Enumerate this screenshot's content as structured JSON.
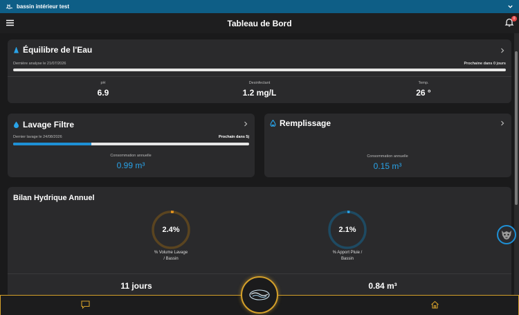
{
  "pool_bar": {
    "name": "bassin intérieur test"
  },
  "header": {
    "title": "Tableau de Bord",
    "notification_count": "0"
  },
  "water_balance": {
    "title": "Équilibre de l'Eau",
    "last_analysis": "Dernière analyse le 21/07/2026",
    "next": "Prochaine dans 0 jours",
    "progress": 1.0,
    "metrics": [
      {
        "label": "pH",
        "value": "6.9"
      },
      {
        "label": "Desinfectant",
        "value": "1.2 mg/L"
      },
      {
        "label": "Temp.",
        "value": "26 °"
      }
    ]
  },
  "filter_wash": {
    "title": "Lavage Filtre",
    "last_wash": "Dernier lavage le 24/08/2026",
    "next": "Prochain dans 5j",
    "progress": 0.33,
    "consumption_label": "Consommation annuelle",
    "consumption_value": "0.99 m³"
  },
  "filling": {
    "title": "Remplissage",
    "consumption_label": "Consommation annuelle",
    "consumption_value": "0.15 m³"
  },
  "annual": {
    "title": "Bilan Hydrique Annuel",
    "rings": [
      {
        "value": "2.4%",
        "fraction": 0.024,
        "label_line1": "% Volume Lavage",
        "label_line2": "/ Bassin",
        "color": "#e8961e",
        "track": "#5a4420"
      },
      {
        "value": "2.1%",
        "fraction": 0.021,
        "label_line1": "% Apport Pluie /",
        "label_line2": "Bassin",
        "color": "#29a3e8",
        "track": "#1e4a62"
      }
    ],
    "stats": [
      "11 jours",
      "0.84 m³"
    ]
  },
  "colors": {
    "accent": "#1e90d6",
    "gold": "#d4a02a",
    "pool_bar": "#0e5e86"
  },
  "icons": [
    "pool-icon",
    "chevron-down-icon",
    "menu-icon",
    "bell-icon",
    "drop-icon",
    "chevron-right-icon",
    "chat-icon",
    "home-icon",
    "logo-wave-icon",
    "avatar-icon"
  ]
}
